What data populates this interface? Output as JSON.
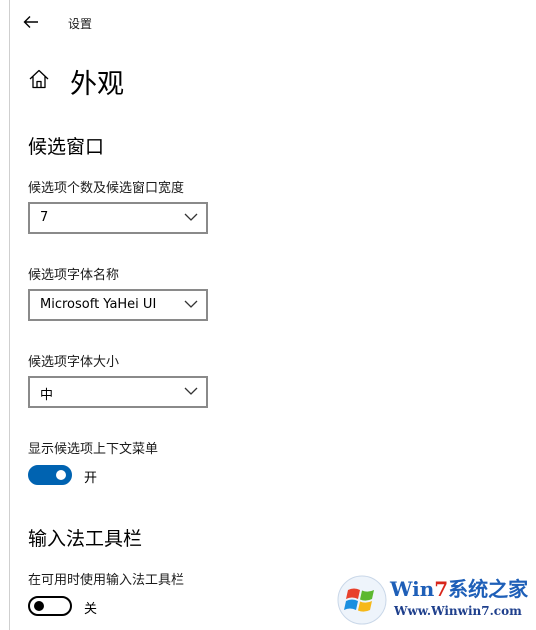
{
  "window": {
    "title": "设置"
  },
  "page": {
    "title": "外观"
  },
  "sections": [
    {
      "title": "候选窗口"
    },
    {
      "title": "输入法工具栏"
    }
  ],
  "fields": {
    "candidate_count": {
      "label": "候选项个数及候选窗口宽度",
      "value": "7"
    },
    "font_name": {
      "label": "候选项字体名称",
      "value": "Microsoft YaHei UI"
    },
    "font_size": {
      "label": "候选项字体大小",
      "value": "中"
    },
    "context_menu": {
      "label": "显示候选项上下文菜单",
      "state": "开",
      "on": true
    },
    "toolbar": {
      "label": "在可用时使用输入法工具栏",
      "state": "关",
      "on": false
    }
  },
  "watermark": {
    "brand_prefix": "Win",
    "brand_number": "7",
    "brand_suffix": "系统之家",
    "url": "Www.Winwin7.com"
  },
  "colors": {
    "accent": "#0063b1",
    "watermark_blue": "#1e5fb8",
    "watermark_red": "#d8261b"
  },
  "icons": [
    "back-arrow-icon",
    "home-icon",
    "chevron-down-icon",
    "windows-logo-icon"
  ]
}
